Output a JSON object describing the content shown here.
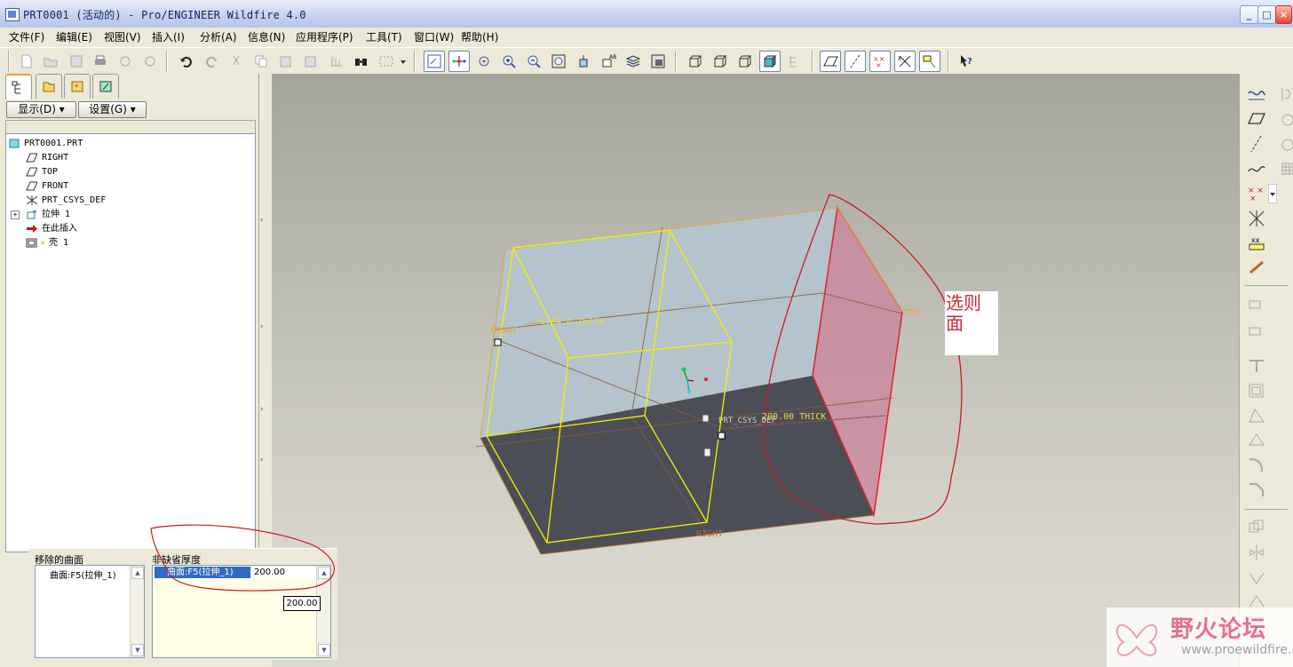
{
  "window": {
    "title": "PRT0001 (活动的) - Pro/ENGINEER Wildfire 4.0"
  },
  "menu": [
    "文件(F)",
    "编辑(E)",
    "视图(V)",
    "插入(I)",
    "分析(A)",
    "信息(N)",
    "应用程序(P)",
    "工具(T)",
    "窗口(W)",
    "帮助(H)"
  ],
  "navigator": {
    "show_button": "显示(D) ▾",
    "settings_button": "设置(G) ▾",
    "tree": [
      {
        "label": "PRT0001.PRT",
        "icon": "part-icon"
      },
      {
        "label": "RIGHT",
        "icon": "datum-plane-icon"
      },
      {
        "label": "TOP",
        "icon": "datum-plane-icon"
      },
      {
        "label": "FRONT",
        "icon": "datum-plane-icon"
      },
      {
        "label": "PRT_CSYS_DEF",
        "icon": "csys-icon"
      },
      {
        "label": "拉伸 1",
        "icon": "extrude-icon"
      },
      {
        "label": "在此插入",
        "icon": "insert-arrow-icon"
      },
      {
        "label": "壳 1",
        "icon": "shell-icon"
      }
    ]
  },
  "dashboard": {
    "removed_surfaces_label": "移除的曲面",
    "removed_surfaces": [
      "曲面:F5(拉伸_1)"
    ],
    "non_default_thickness_label": "非缺省厚度",
    "thickness_rows": [
      {
        "surface": "曲面:F5(拉伸_1)",
        "value": "200.00"
      }
    ],
    "thickness_input": "200.00"
  },
  "viewport": {
    "labels": {
      "front": "FRONT",
      "top": "TOP",
      "right": "RIGHT",
      "thick1": "6.64 O_THICK",
      "thick2": "200.00 THICK",
      "csys": "PRT_CSYS_DEF"
    },
    "note": "选则面"
  },
  "watermark": {
    "title": "野火论坛",
    "url": "www.proewildfire.cn"
  },
  "colors": {
    "highlight_yellow": "#f6f000",
    "selected_face": "#c98aa0",
    "annotation_red": "#d2262f",
    "edge_orange": "#e8a23c"
  }
}
